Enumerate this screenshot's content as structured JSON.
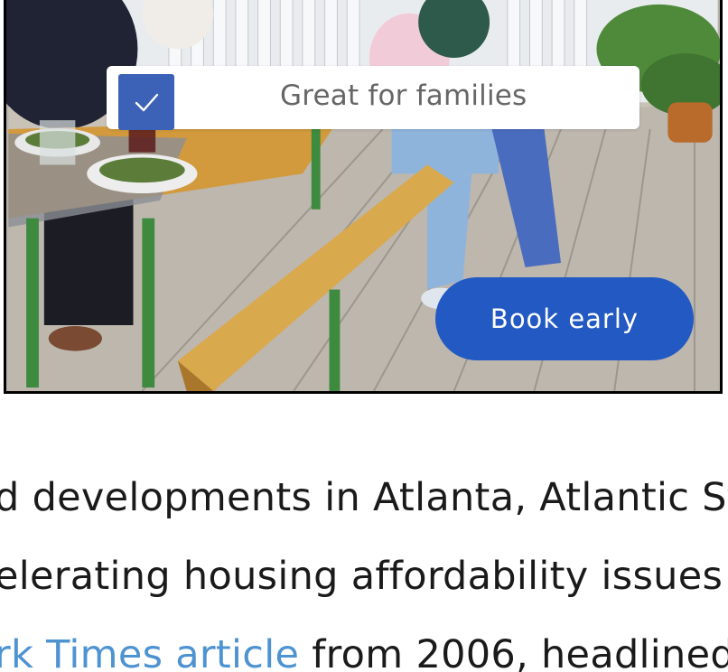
{
  "image_card": {
    "badge": {
      "checked": true,
      "label": "Great for families",
      "checkbox_color": "#3b62b7"
    },
    "cta_button": {
      "label": "Book early",
      "color": "#2359c3"
    }
  },
  "article": {
    "line1": "d developments in Atlanta, Atlantic Sta",
    "line2": "elerating housing affordability issues in",
    "line3_link": "rk Times article",
    "line3_rest": " from 2006, headlined"
  },
  "colors": {
    "link": "#4e93d1",
    "text": "#1a1a1a"
  }
}
